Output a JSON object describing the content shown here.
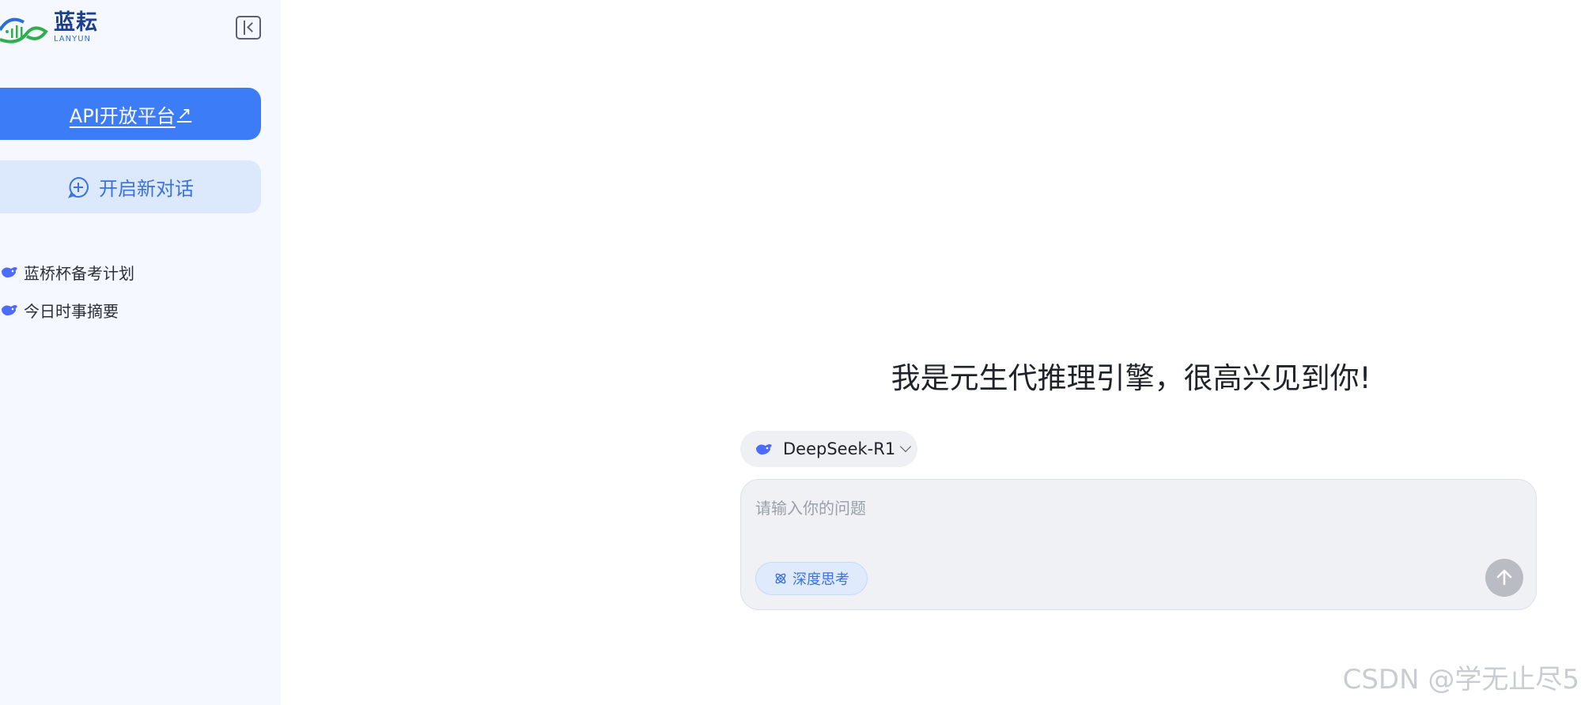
{
  "sidebar": {
    "logo": {
      "cn": "蓝耘",
      "en": "LANYUN"
    },
    "collapse_icon": "sidebar-collapse-icon",
    "api_button": {
      "label": "API开放平台",
      "icon": "↗"
    },
    "new_chat_button": {
      "label": "开启新对话"
    },
    "history": [
      {
        "label": "蓝桥杯备考计划",
        "icon": "whale-icon"
      },
      {
        "label": "今日时事摘要",
        "icon": "whale-icon"
      }
    ]
  },
  "main": {
    "greeting": "我是元生代推理引擎，很高兴见到你!",
    "model_selector": {
      "label": "DeepSeek-R1"
    },
    "input": {
      "placeholder": "请输入你的问题",
      "value": ""
    },
    "deep_think_button": {
      "label": "深度思考"
    }
  },
  "watermark": "CSDN @学无止尽5",
  "colors": {
    "accent": "#3d7cf7",
    "sidebar_bg": "#f5f8ff",
    "new_chat_bg": "#dce8fc",
    "send_disabled": "#b9bcc2"
  }
}
